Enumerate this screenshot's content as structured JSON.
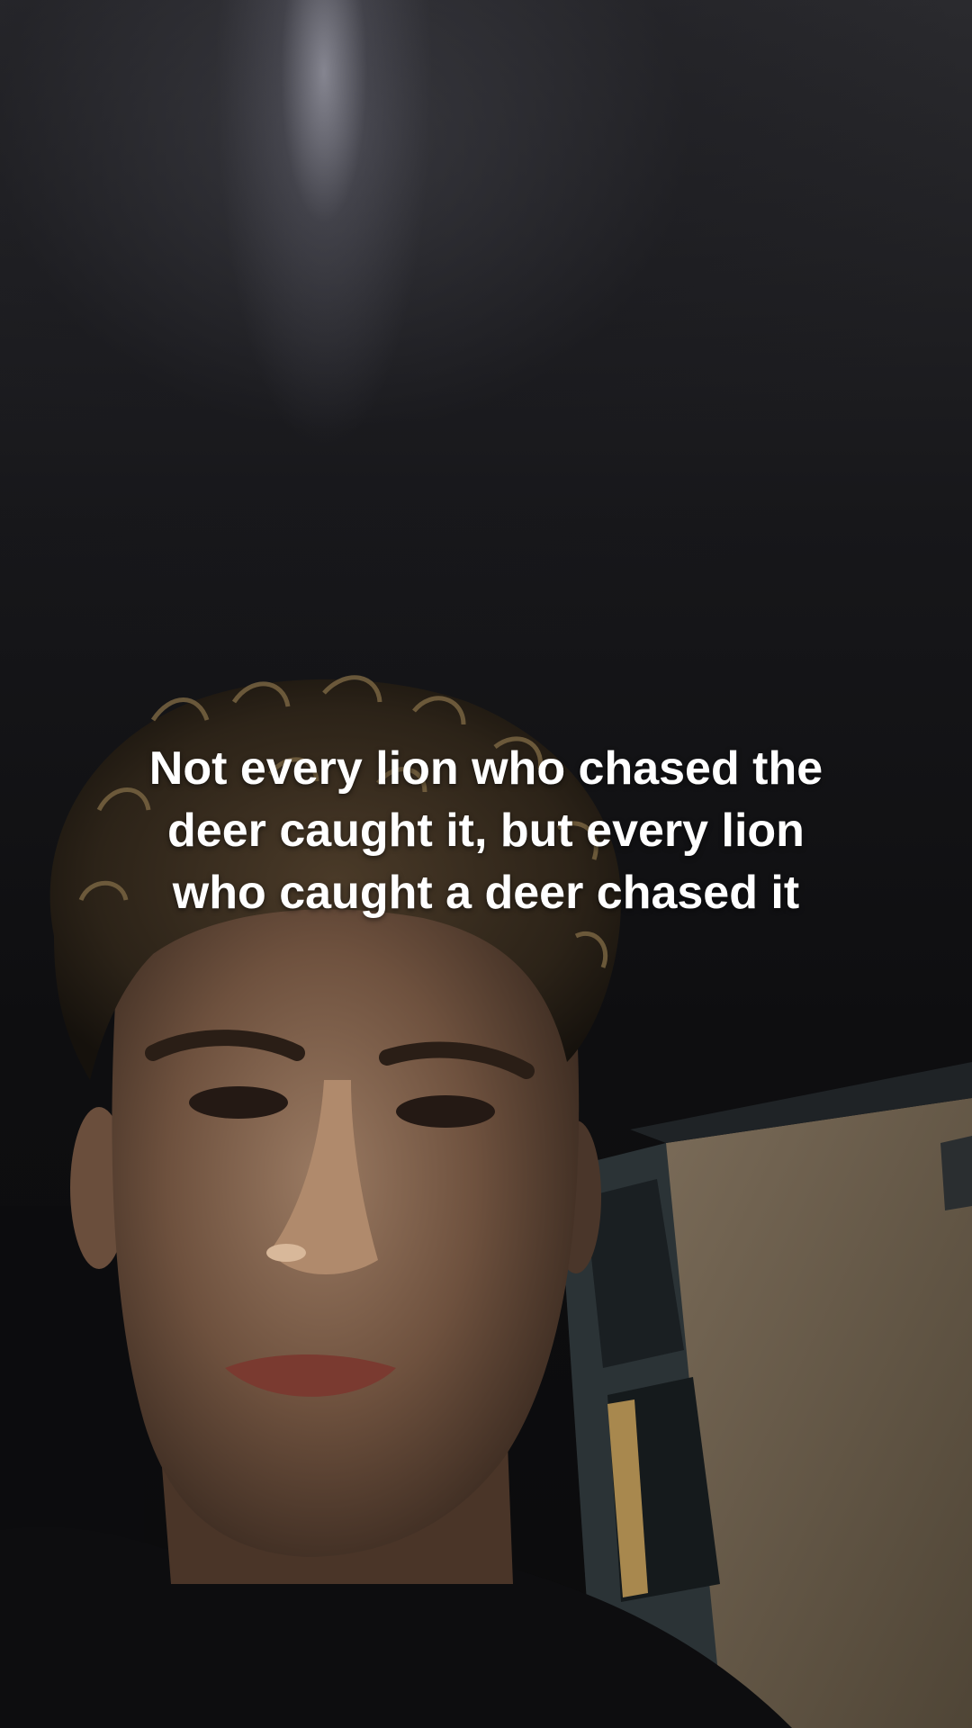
{
  "caption": {
    "text": "Not every lion who chased the deer caught it, but every lion who caught a deer chased it"
  },
  "colors": {
    "caption_text": "#ffffff",
    "background_top": "#2a2a2e",
    "background_bottom": "#0b0b0c",
    "wall": "#6e6150"
  }
}
